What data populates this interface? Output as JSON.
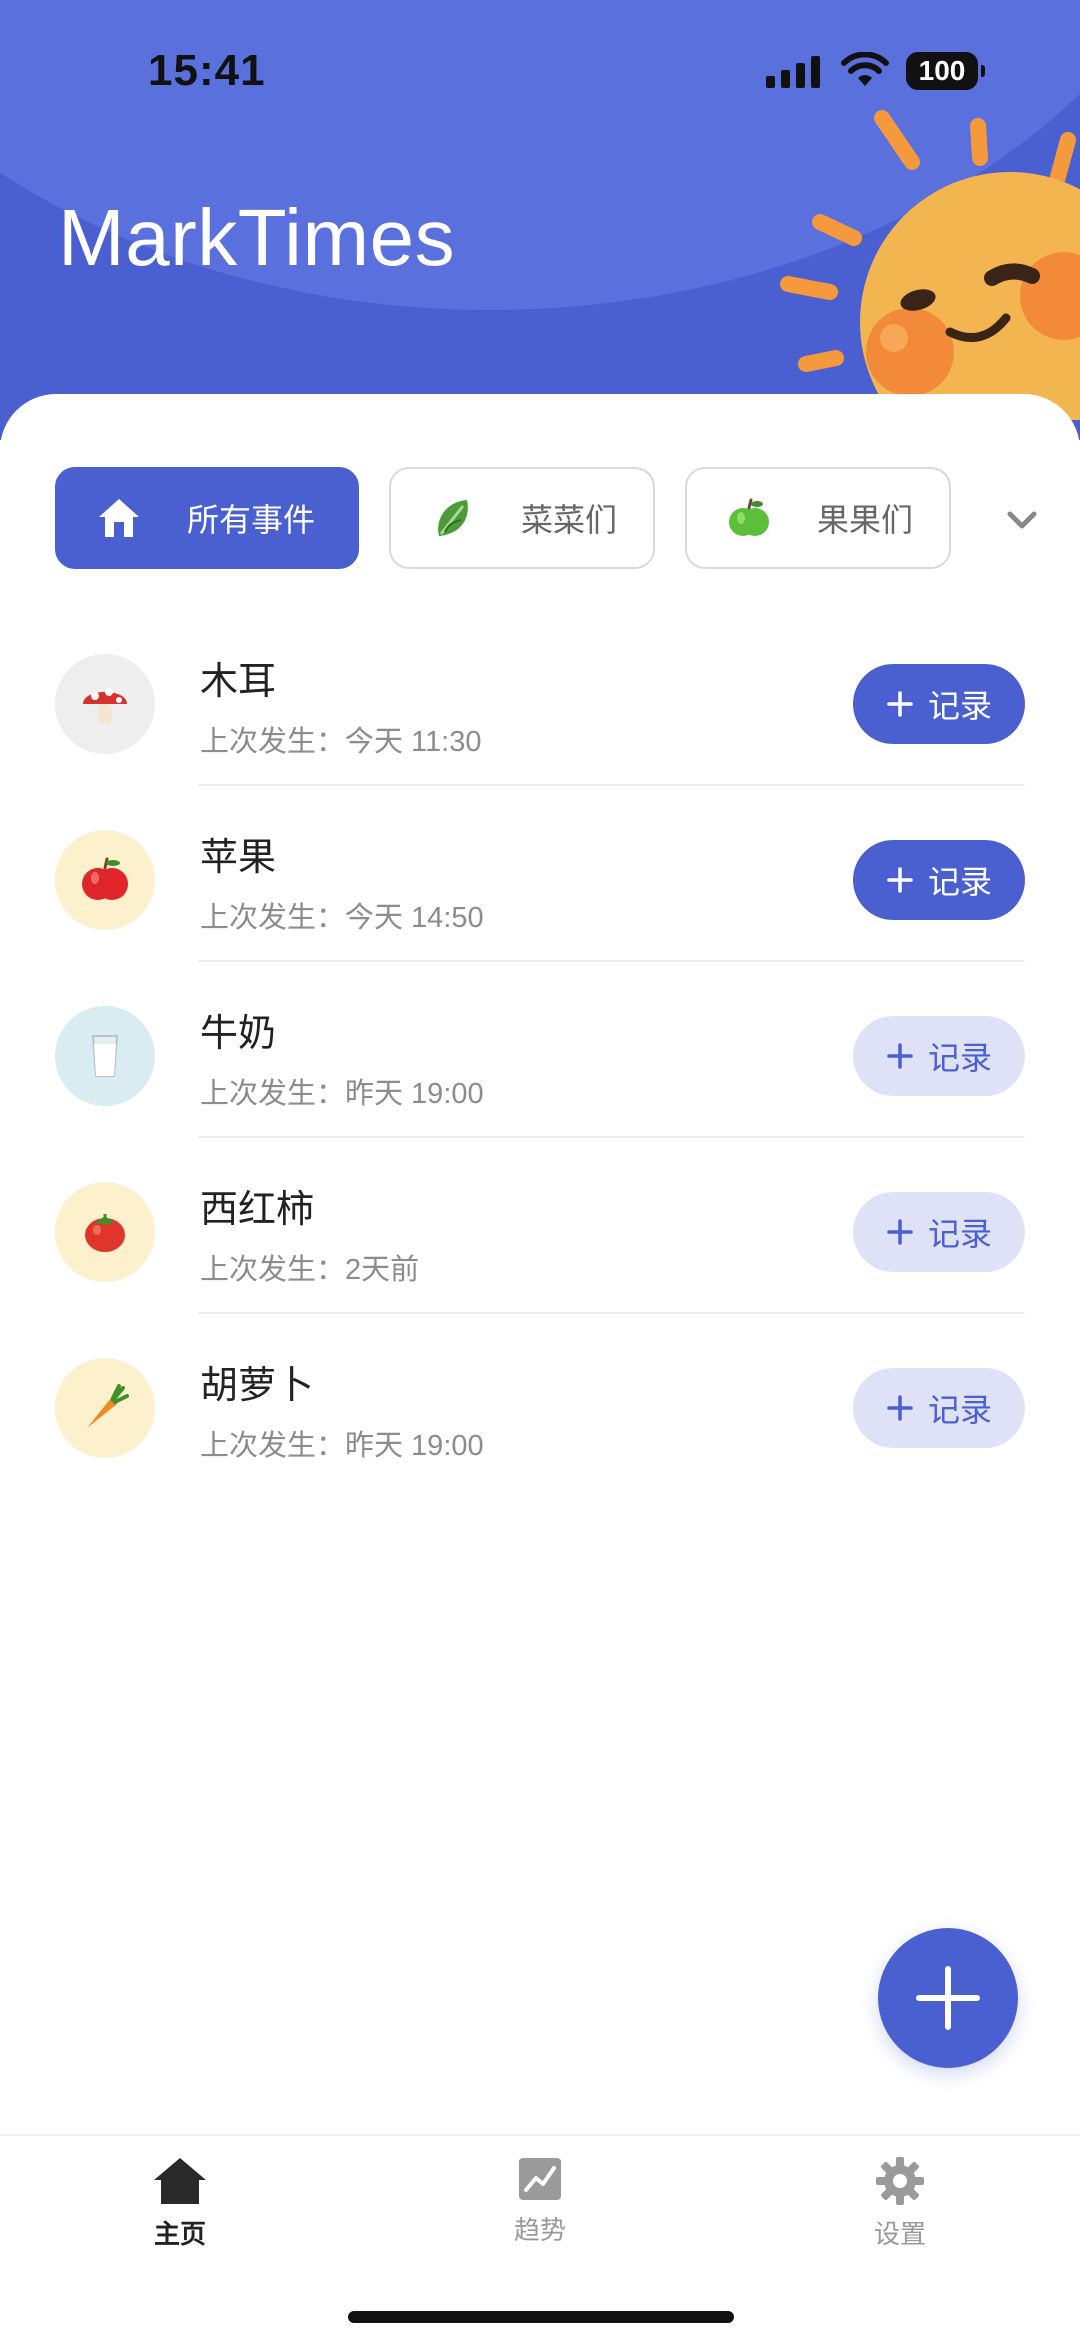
{
  "status_bar": {
    "time": "15:41",
    "battery": "100"
  },
  "header": {
    "title": "MarkTimes"
  },
  "colors": {
    "accent": "#4a5fd0",
    "accent_light": "#dfe2f6"
  },
  "categories": [
    {
      "label": "所有事件",
      "icon": "home-icon",
      "active": true
    },
    {
      "label": "菜菜们",
      "icon": "leafy-green-icon",
      "active": false
    },
    {
      "label": "果果们",
      "icon": "green-apple-icon",
      "active": false
    }
  ],
  "events": [
    {
      "name": "木耳",
      "last": "上次发生：今天 11:30",
      "icon": "mushroom-icon",
      "record_label": "记录"
    },
    {
      "name": "苹果",
      "last": "上次发生：今天 14:50",
      "icon": "red-apple-icon",
      "record_label": "记录"
    },
    {
      "name": "牛奶",
      "last": "上次发生：昨天 19:00",
      "icon": "milk-glass-icon",
      "record_label": "记录"
    },
    {
      "name": "西红柿",
      "last": "上次发生：2天前",
      "icon": "tomato-icon",
      "record_label": "记录"
    },
    {
      "name": "胡萝卜",
      "last": "上次发生：昨天 19:00",
      "icon": "carrot-icon",
      "record_label": "记录"
    }
  ],
  "nav": [
    {
      "label": "主页",
      "icon": "home-icon",
      "active": true
    },
    {
      "label": "趋势",
      "icon": "chart-icon",
      "active": false
    },
    {
      "label": "设置",
      "icon": "gear-icon",
      "active": false
    }
  ]
}
